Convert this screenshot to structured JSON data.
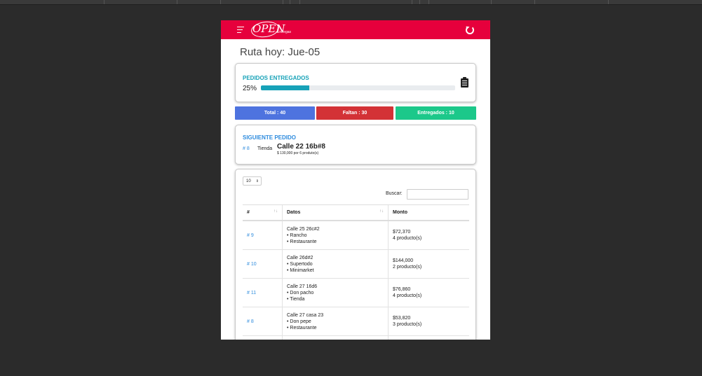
{
  "app": {
    "logo_text": "OPEN",
    "logo_subtext": "Entregas",
    "brand_color": "#e6003c"
  },
  "page_title": "Ruta hoy: Jue-05",
  "delivered_card": {
    "title": "PEDIDOS ENTREGADOS",
    "percent_label": "25%",
    "progress_fraction": 0.25,
    "icon": "clipboard-list-icon"
  },
  "stats": {
    "total": "Total : 40",
    "faltan": "Faltan : 30",
    "entregados": "Entregados : 10"
  },
  "next_order": {
    "title": "SIGUIENTE PEDIDO",
    "number": "# 8",
    "type": "Tienda",
    "address": "Calle 22 16b#8",
    "detail": "$ 130,000 por 6 produto(s)"
  },
  "table": {
    "page_length": "10",
    "search_label": "Buscar:",
    "search_value": "",
    "columns": [
      "#",
      "Datos",
      "Monto"
    ],
    "rows": [
      {
        "num": "# 9",
        "address": "Calle 25 26c#2",
        "line1": "• Rancho",
        "line2": "• Restaurante",
        "amount": "$72,370",
        "products": "4 producto(s)"
      },
      {
        "num": "# 10",
        "address": "Calle 26d#2",
        "line1": "• Supertodo",
        "line2": "• Minimarket",
        "amount": "$144,000",
        "products": "2 producto(s)"
      },
      {
        "num": "# 11",
        "address": "Calle 27 16d6",
        "line1": "• Don pacho",
        "line2": "• Tienda",
        "amount": "$76,860",
        "products": "4 producto(s)"
      },
      {
        "num": "# 8",
        "address": "Calle 27 casa 23",
        "line1": "• Don pepe",
        "line2": "• Restaurante",
        "amount": "$53,820",
        "products": "3 producto(s)"
      }
    ]
  }
}
